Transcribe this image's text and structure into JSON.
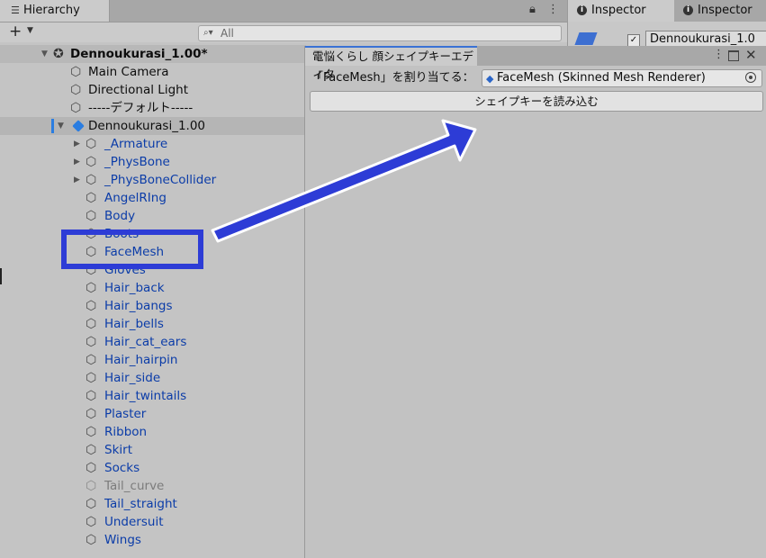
{
  "hierarchy": {
    "tab_label": "Hierarchy",
    "search_placeholder": "All",
    "scene_name": "Dennoukurasi_1.00*",
    "rows": [
      {
        "label": "Main Camera"
      },
      {
        "label": "Directional Light"
      },
      {
        "label": "-----デフォルト-----"
      },
      {
        "label": "Dennoukurasi_1.00"
      },
      {
        "label": "_Armature"
      },
      {
        "label": "_PhysBone"
      },
      {
        "label": "_PhysBoneCollider"
      },
      {
        "label": "AngelRIng"
      },
      {
        "label": "Body"
      },
      {
        "label": "Boots"
      },
      {
        "label": "FaceMesh"
      },
      {
        "label": "Gloves"
      },
      {
        "label": "Hair_back"
      },
      {
        "label": "Hair_bangs"
      },
      {
        "label": "Hair_bells"
      },
      {
        "label": "Hair_cat_ears"
      },
      {
        "label": "Hair_hairpin"
      },
      {
        "label": "Hair_side"
      },
      {
        "label": "Hair_twintails"
      },
      {
        "label": "Plaster"
      },
      {
        "label": "Ribbon"
      },
      {
        "label": "Skirt"
      },
      {
        "label": "Socks"
      },
      {
        "label": "Tail_curve"
      },
      {
        "label": "Tail_straight"
      },
      {
        "label": "Undersuit"
      },
      {
        "label": "Wings"
      }
    ]
  },
  "inspector": {
    "tab1_label": "Inspector",
    "tab2_label": "Inspector",
    "object_name": "Dennoukurasi_1.0"
  },
  "editor": {
    "title": "電悩くらし 顔シェイプキーエディタ",
    "assign_label": "「FaceMesh」を割り当てる：",
    "mesh_value": "FaceMesh (Skinned Mesh Renderer)",
    "load_button": "シェイプキーを読み込む"
  },
  "colors": {
    "highlight": "#2d3cd6",
    "prefab_blue": "#0b3ca8"
  }
}
